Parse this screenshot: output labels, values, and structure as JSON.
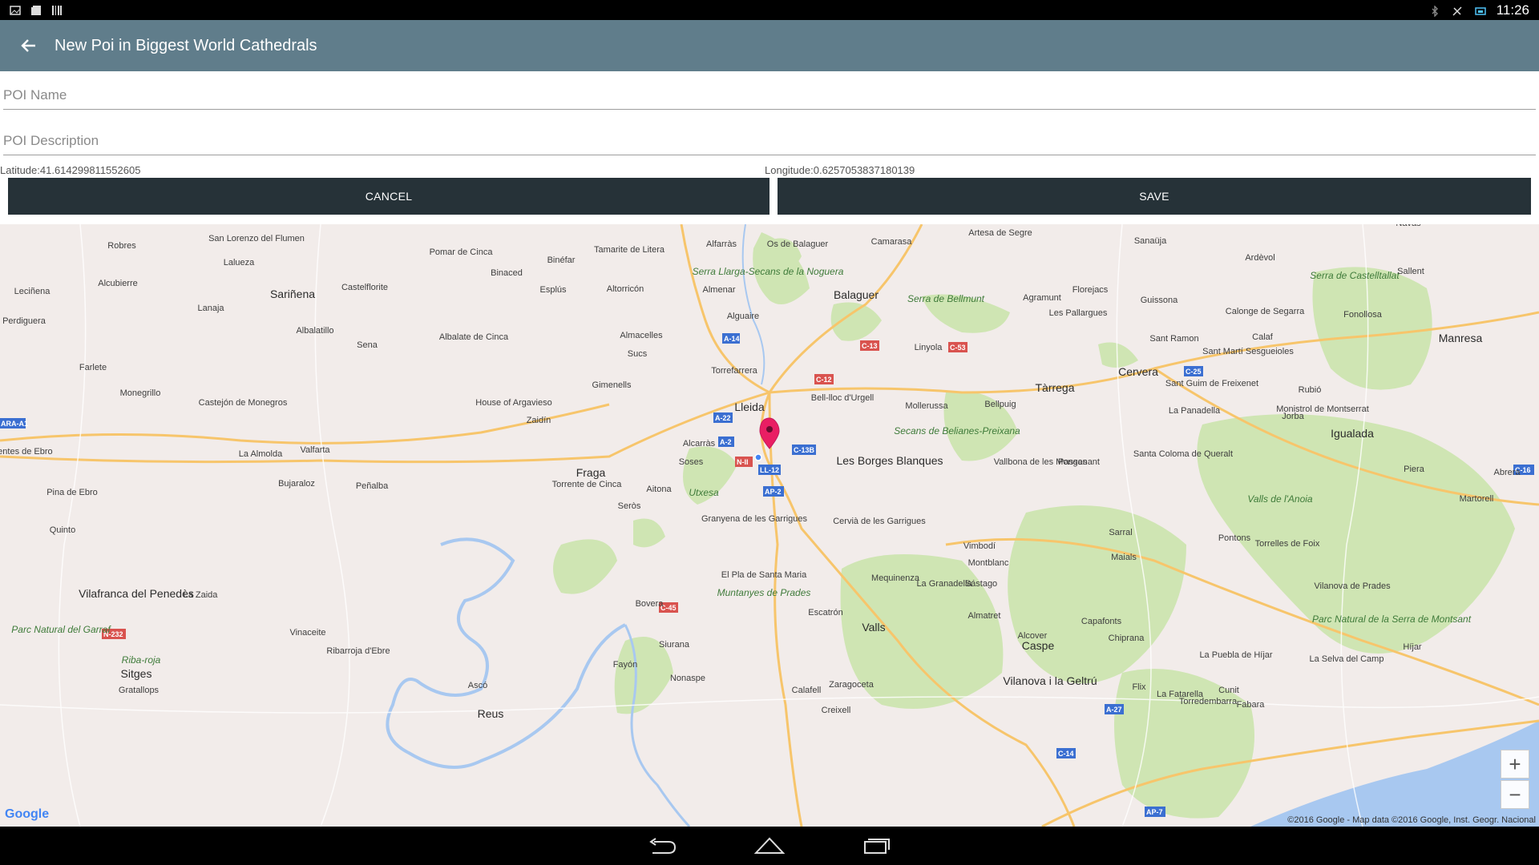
{
  "status_bar": {
    "time": "11:26"
  },
  "app_bar": {
    "title": "New Poi in Biggest World Cathedrals"
  },
  "form": {
    "name_placeholder": "POI Name",
    "name_value": "",
    "description_placeholder": "POI Description",
    "description_value": "",
    "latitude_text": "Latitude:41.614299811552605",
    "longitude_text": "Longitude:0.6257053837180139",
    "cancel_label": "CANCEL",
    "save_label": "SAVE"
  },
  "map": {
    "google_logo": "Google",
    "attribution": "©2016 Google - Map data ©2016 Google, Inst. Geogr. Nacional",
    "zoom_in": "+",
    "zoom_out": "−",
    "colors": {
      "land": "#f2ecea",
      "park": "#cfe5b3",
      "water": "#a8c8f0",
      "road": "#f7c56b",
      "marker": "#e91e63"
    },
    "places": [
      "Robres",
      "San Lorenzo del Flumen",
      "Pomar de Cinca",
      "Binéfar",
      "Tamarite de Litera",
      "Alfarràs",
      "Os de Balaguer",
      "Camarasa",
      "Artesa de Segre",
      "Sanaüja",
      "Ardèvol",
      "Navàs",
      "Lalueza",
      "Binaced",
      "Serra Llarga-Secans de la Noguera",
      "Alcubierre",
      "Leciñena",
      "Sariñena",
      "Castelflorite",
      "Esplús",
      "Altorricón",
      "Almenar",
      "Balaguer",
      "Serra de Bellmunt",
      "Agramunt",
      "Florejacs",
      "Guissona",
      "Serra de Castelltallat",
      "Sallent",
      "Lanaja",
      "Alguaire",
      "Les Pallargues",
      "Calonge de Segarra",
      "Fonollosa",
      "Perdiguera",
      "Albalatillo",
      "Albalate de Cinca",
      "Almacelles",
      "Linyola",
      "Sant Ramon",
      "Calaf",
      "Manresa",
      "Sena",
      "Sucs",
      "Sant Martí Sesgueioles",
      "Farlete",
      "Torrefarrera",
      "Cervera",
      "Monegrillo",
      "Gimenells",
      "Tàrrega",
      "Sant Guim de Freixenet",
      "Castejón de Monegros",
      "House of Argavieso",
      "Bell-lloc d'Urgell",
      "Mollerussa",
      "Bellpuig",
      "Rubió",
      "Zaidín",
      "Lleida",
      "La Panadella",
      "Jorba",
      "Monistrol de Montserrat",
      "Secans de Belianes-Preixana",
      "Igualada",
      "La Almolda",
      "Valfarta",
      "Alcarràs",
      "Fuentes de Ebro",
      "Fraga",
      "Soses",
      "Les Borges Blanques",
      "Vallbona de les Monges",
      "Passanant",
      "Santa Coloma de Queralt",
      "Piera",
      "Abrera",
      "Bujaraloz",
      "Peñalba",
      "Pina de Ebro",
      "Aitona",
      "Utxesa",
      "Torrente de Cinca",
      "Seròs",
      "Valls de l'Anoia",
      "Martorell",
      "Granyena de les Garrigues",
      "Cervià de les Garrigues",
      "Sarral",
      "Quinto",
      "Pontons",
      "Torrelles de Foix",
      "Vimbodí",
      "Mequinenza",
      "Montblanc",
      "Maials",
      "El Pla de Santa Maria",
      "La Granadella",
      "Vilanova de Prades",
      "Vilafranca del Penedès",
      "La Zaida",
      "Sástago",
      "Muntanyes de Prades",
      "Bovera",
      "Almatret",
      "Capafonts",
      "Valls",
      "Escatrón",
      "Parc Natural de la Serra de Montsant",
      "Parc Natural del Garraf",
      "Vinaceite",
      "Chiprana",
      "Alcover",
      "Ribarroja d'Ebre",
      "Siurana",
      "Caspe",
      "Fayón",
      "Riba-roja",
      "La Puebla de Híjar",
      "La Selva del Camp",
      "Sitges",
      "Vilanova i la Geltrú",
      "Nonaspe",
      "Flix",
      "Híjar",
      "Gratallops",
      "Calafell",
      "Cunit",
      "Fabara",
      "Ascó",
      "Zaragoceta",
      "La Fatarella",
      "Reus",
      "Creixell",
      "Torredembarra"
    ],
    "road_labels": [
      "A-14",
      "A-22",
      "A-2",
      "C-12",
      "C-13",
      "C-53",
      "C-25",
      "C-13B",
      "N-II",
      "LL-12",
      "AP-2",
      "C-45",
      "N-232",
      "A-27",
      "C-14",
      "AP-7",
      "C-16",
      "ARA-A1"
    ]
  }
}
